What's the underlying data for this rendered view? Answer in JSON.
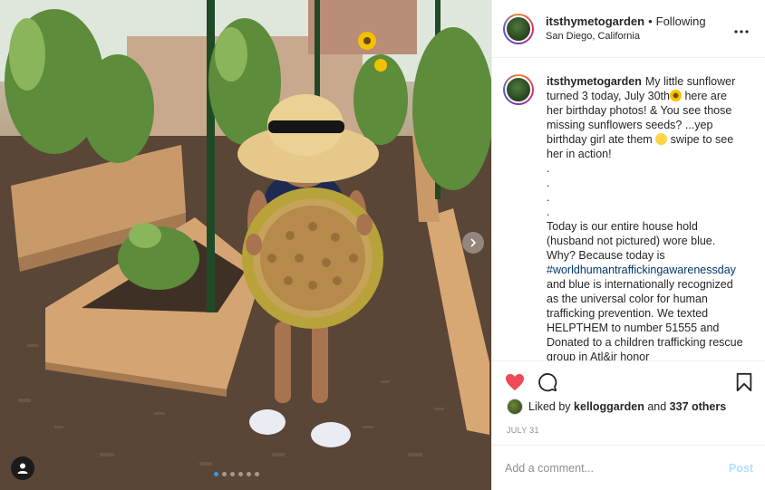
{
  "post": {
    "username": "itsthymetogarden",
    "separator": "•",
    "following_label": "Following",
    "location": "San Diego, California",
    "more_label": "•••"
  },
  "caption": {
    "username": "itsthymetogarden",
    "part1": "My little sunflower turned 3 today, July 30th",
    "part2": " here are her birthday photos! & You see those missing sunflowers seeds? ...yep birthday girl ate them ",
    "part3": " swipe to see her in action!",
    "dots": [
      ".",
      ".",
      ".",
      "."
    ],
    "part4": "Today is our entire house hold (husband not pictured) wore blue. Why? Because today is ",
    "hashtag": "#worldhumantraffickingawarenessday",
    "part5": " and blue is internationally recognized as the universal color for human trafficking prevention. We texted HELPTHEM to number 51555 and Donated to a children trafficking rescue group in Atl&ir honor"
  },
  "likes": {
    "prefix": "Liked by",
    "user": "kelloggarden",
    "conjunction": "and",
    "others": "337 others"
  },
  "date": "JULY 31",
  "comment": {
    "placeholder": "Add a comment...",
    "post_label": "Post"
  },
  "carousel": {
    "count": 6,
    "active_index": 0
  },
  "colors": {
    "like_red": "#ed4956",
    "link_blue": "#00376b",
    "post_disabled": "#b2dffc",
    "muted": "#8e8e8e"
  },
  "icons": {
    "like": "heart-icon",
    "comment": "comment-bubble-icon",
    "save": "bookmark-icon",
    "user_tag": "user-tag-icon",
    "more": "more-options-icon"
  }
}
